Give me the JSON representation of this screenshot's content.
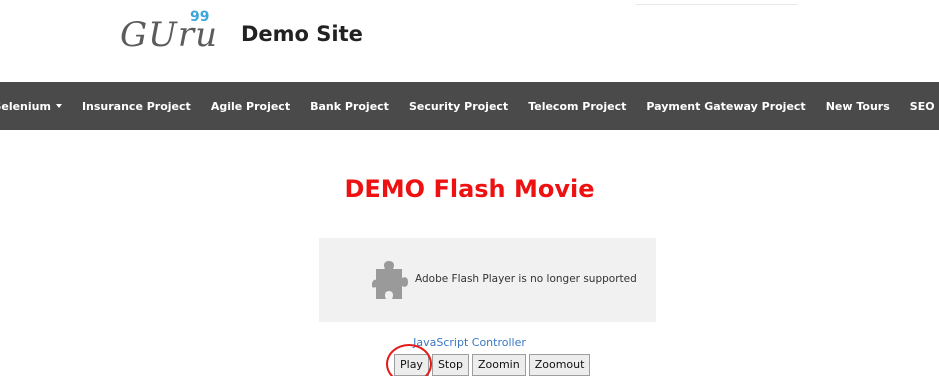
{
  "header": {
    "logo_text": "GUru",
    "logo_superscript": "99",
    "site_title": "Demo Site"
  },
  "navbar": {
    "items": [
      {
        "label": "Selenium",
        "dropdown": true
      },
      {
        "label": "Insurance Project",
        "dropdown": false
      },
      {
        "label": "Agile Project",
        "dropdown": false
      },
      {
        "label": "Bank Project",
        "dropdown": false
      },
      {
        "label": "Security Project",
        "dropdown": false
      },
      {
        "label": "Telecom Project",
        "dropdown": false
      },
      {
        "label": "Payment Gateway Project",
        "dropdown": false
      },
      {
        "label": "New Tours",
        "dropdown": false
      },
      {
        "label": "SEO",
        "dropdown": true
      }
    ]
  },
  "main": {
    "title": "DEMO Flash Movie",
    "flash_message": "Adobe Flash Player is no longer supported",
    "plugin_icon": "puzzle-piece-icon",
    "controller_label": "JavaScript Controller",
    "buttons": [
      "Play",
      "Stop",
      "Zoomin",
      "Zoomout"
    ]
  },
  "colors": {
    "navbar_bg": "#4a4a4a",
    "title_red": "#ee1111",
    "link_blue": "#3a77c4",
    "logo_accent": "#3ea5d9",
    "highlight": "#e31b1b"
  }
}
